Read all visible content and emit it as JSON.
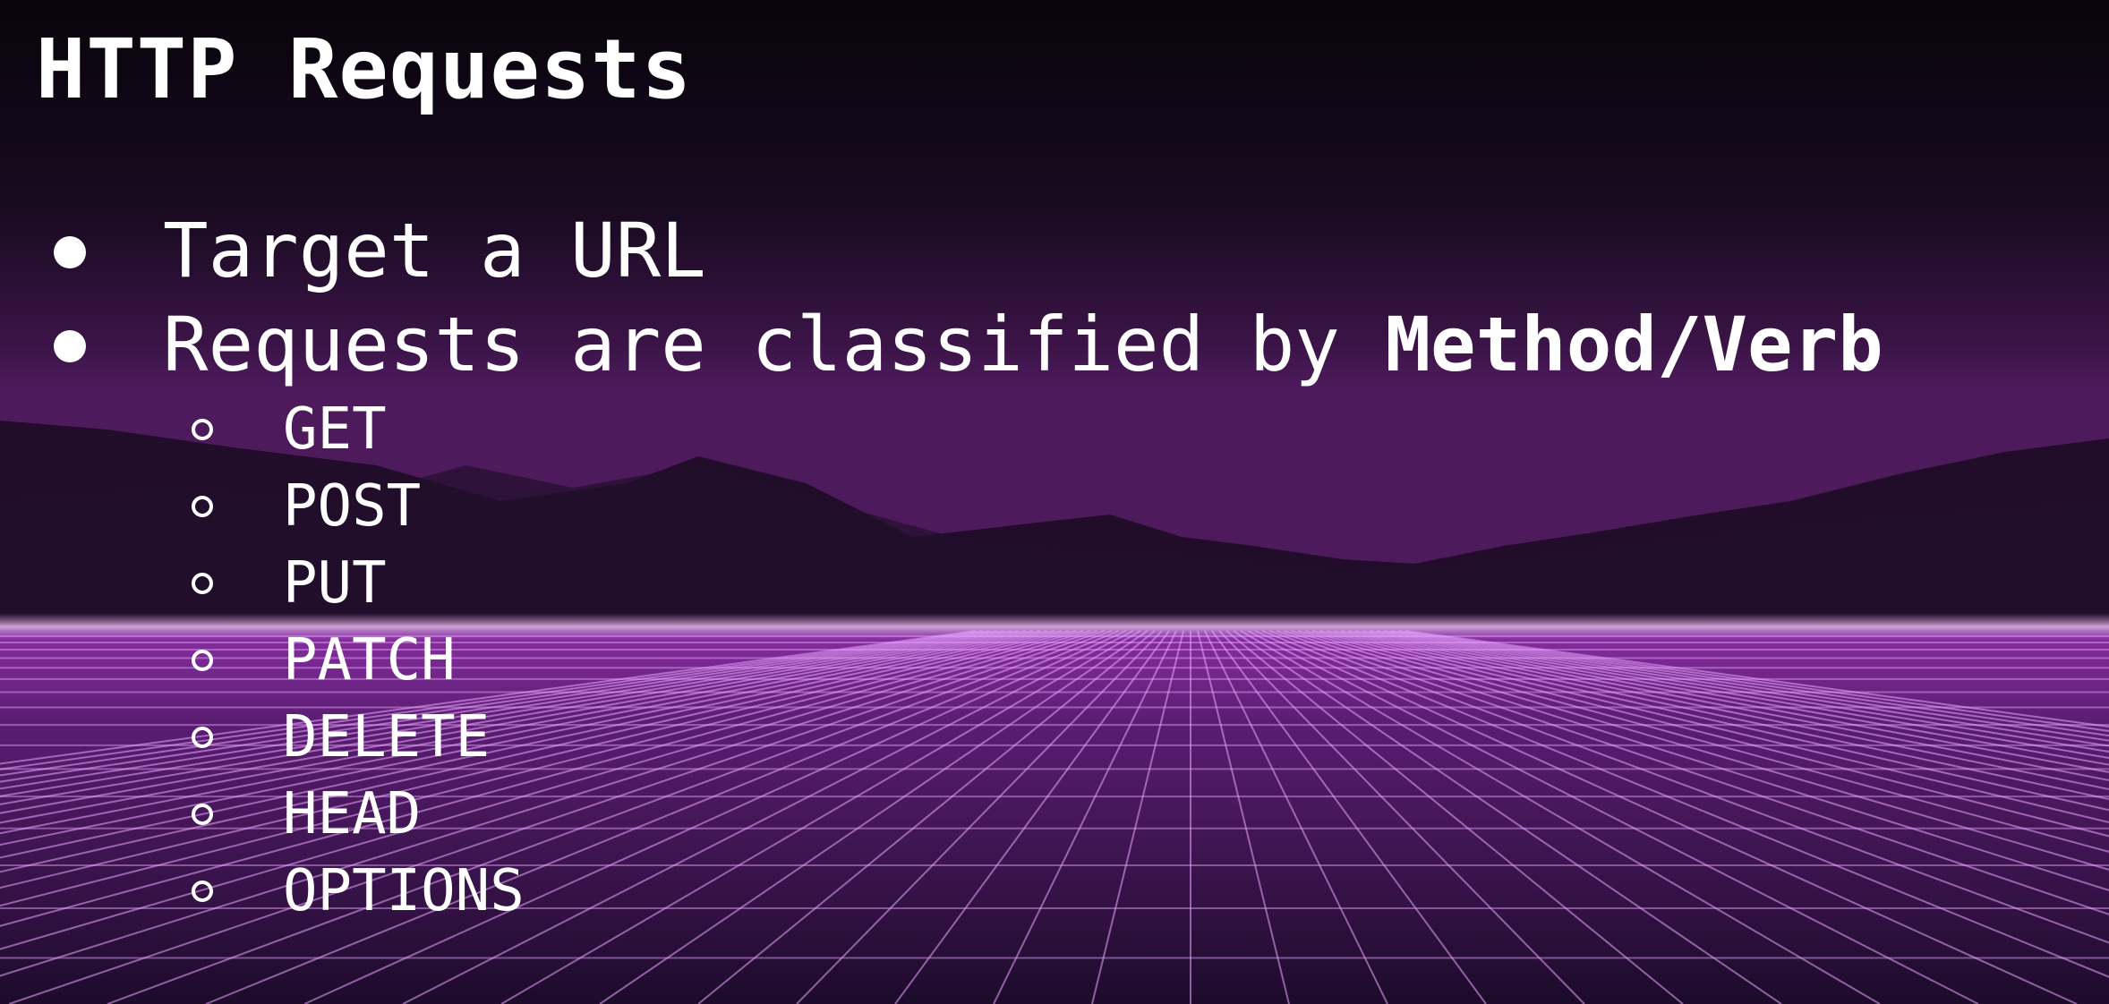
{
  "slide": {
    "title": "HTTP Requests",
    "bullets": [
      {
        "text": "Target a URL"
      },
      {
        "text": "Requests are classified by ",
        "bold_text": "Method/Verb"
      }
    ],
    "methods": [
      "GET",
      "POST",
      "PUT",
      "PATCH",
      "DELETE",
      "HEAD",
      "OPTIONS"
    ]
  },
  "colors": {
    "text": "#ffffff",
    "grid_line": "#e9a6ff",
    "horizon_glow": "#c79bd2",
    "floor": "#5a1a6e"
  }
}
